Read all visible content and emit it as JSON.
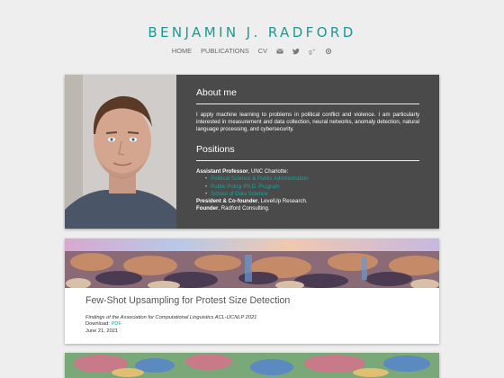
{
  "site": {
    "title": "BENJAMIN J. RADFORD"
  },
  "nav": {
    "items": [
      "HOME",
      "PUBLICATIONS",
      "CV"
    ]
  },
  "about": {
    "heading": "About me",
    "text": "I apply machine learning to problems in political conflict and violence. I am particularly interested in measurement and data collection, neural networks, anomaly detection, natural language processing, and cybersecurity."
  },
  "positions": {
    "heading": "Positions",
    "role1_title": "Assistant Professor",
    "role1_org": ", UNC Charlotte:",
    "links": [
      "Political Science & Public Administration",
      "Public Policy Ph.D. Program",
      "School of Data Science"
    ],
    "role2_title": "President & Co-founder",
    "role2_org": ", LevelUp Research.",
    "role3_title": "Founder",
    "role3_org": ", Radford Consulting."
  },
  "publication": {
    "title": "Few-Shot Upsampling for Protest Size Detection",
    "venue": "Findings of the Association for Computational Linguistics ACL-IJCNLP 2021",
    "download_label": "Download: ",
    "download_link": "PDF",
    "date": "June 21, 2021"
  },
  "icons": [
    "email-icon",
    "twitter-icon",
    "google-scholar-icon",
    "github-icon"
  ],
  "colors": {
    "accent": "#1a9a92",
    "card_dark": "#4a4a4a",
    "background": "#eeeeee"
  }
}
